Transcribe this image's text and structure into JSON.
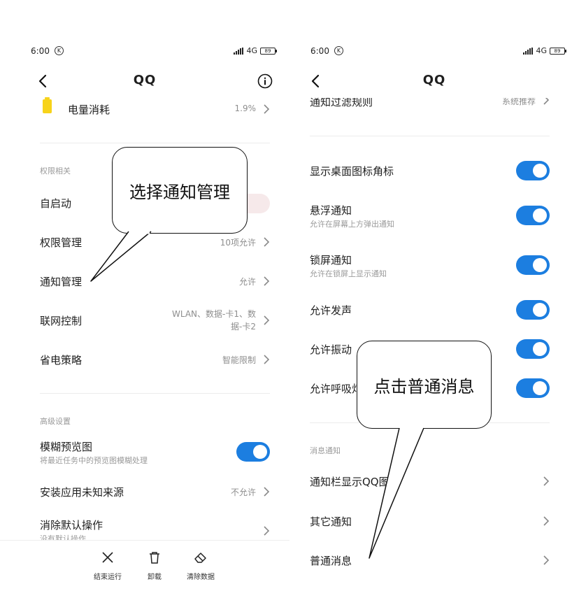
{
  "left": {
    "status": {
      "time": "6:00",
      "k_badge": "K",
      "network": "4G",
      "battery": "89"
    },
    "title": "QQ",
    "battery_row": {
      "label": "电量消耗",
      "value": "1.9%"
    },
    "permissions_section": "权限相关",
    "rows": [
      {
        "label": "自启动",
        "value": ""
      },
      {
        "label": "权限管理",
        "value": "10项允许"
      },
      {
        "label": "通知管理",
        "value": "允许"
      },
      {
        "label": "联网控制",
        "value_line1": "WLAN、数据-卡1、数",
        "value_line2": "据-卡2"
      },
      {
        "label": "省电策略",
        "value": "智能限制"
      }
    ],
    "advanced_section": "高级设置",
    "blur_preview": {
      "label": "模糊预览图",
      "sub": "将最近任务中的预览图模糊处理",
      "on": true
    },
    "unknown_sources": {
      "label": "安装应用未知来源",
      "value": "不允许"
    },
    "clear_defaults": {
      "label": "消除默认操作",
      "sub": "没有默认操作"
    },
    "bottom_bar": {
      "force_stop": "结束运行",
      "uninstall": "卸载",
      "clear_data": "清除数据"
    },
    "callout": "选择通知管理"
  },
  "right": {
    "status": {
      "time": "6:00",
      "k_badge": "K",
      "network": "4G",
      "battery": "89"
    },
    "title": "QQ",
    "filter_row": {
      "label": "通知过滤规则",
      "value": "系统推荐"
    },
    "toggles": [
      {
        "label": "显示桌面图标角标",
        "sub": "",
        "on": true
      },
      {
        "label": "悬浮通知",
        "sub": "允许在屏幕上方弹出通知",
        "on": true
      },
      {
        "label": "锁屏通知",
        "sub": "允许在锁屏上显示通知",
        "on": true
      },
      {
        "label": "允许发声",
        "sub": "",
        "on": true
      },
      {
        "label": "允许振动",
        "sub": "",
        "on": true
      },
      {
        "label": "允许呼吸灯",
        "sub": "",
        "on": true
      }
    ],
    "message_section": "消息通知",
    "message_rows": [
      {
        "label": "通知栏显示QQ图标"
      },
      {
        "label": "其它通知"
      },
      {
        "label": "普通消息"
      }
    ],
    "callout": "点击普通消息"
  },
  "colors": {
    "toggle_on": "#1c7ee0",
    "battery_icon": "#f7d31a"
  },
  "icons": [
    "back-arrow-icon",
    "info-icon",
    "chevron-right-icon",
    "close-x-icon",
    "trash-icon",
    "eraser-icon",
    "battery-icon",
    "signal-icon"
  ]
}
